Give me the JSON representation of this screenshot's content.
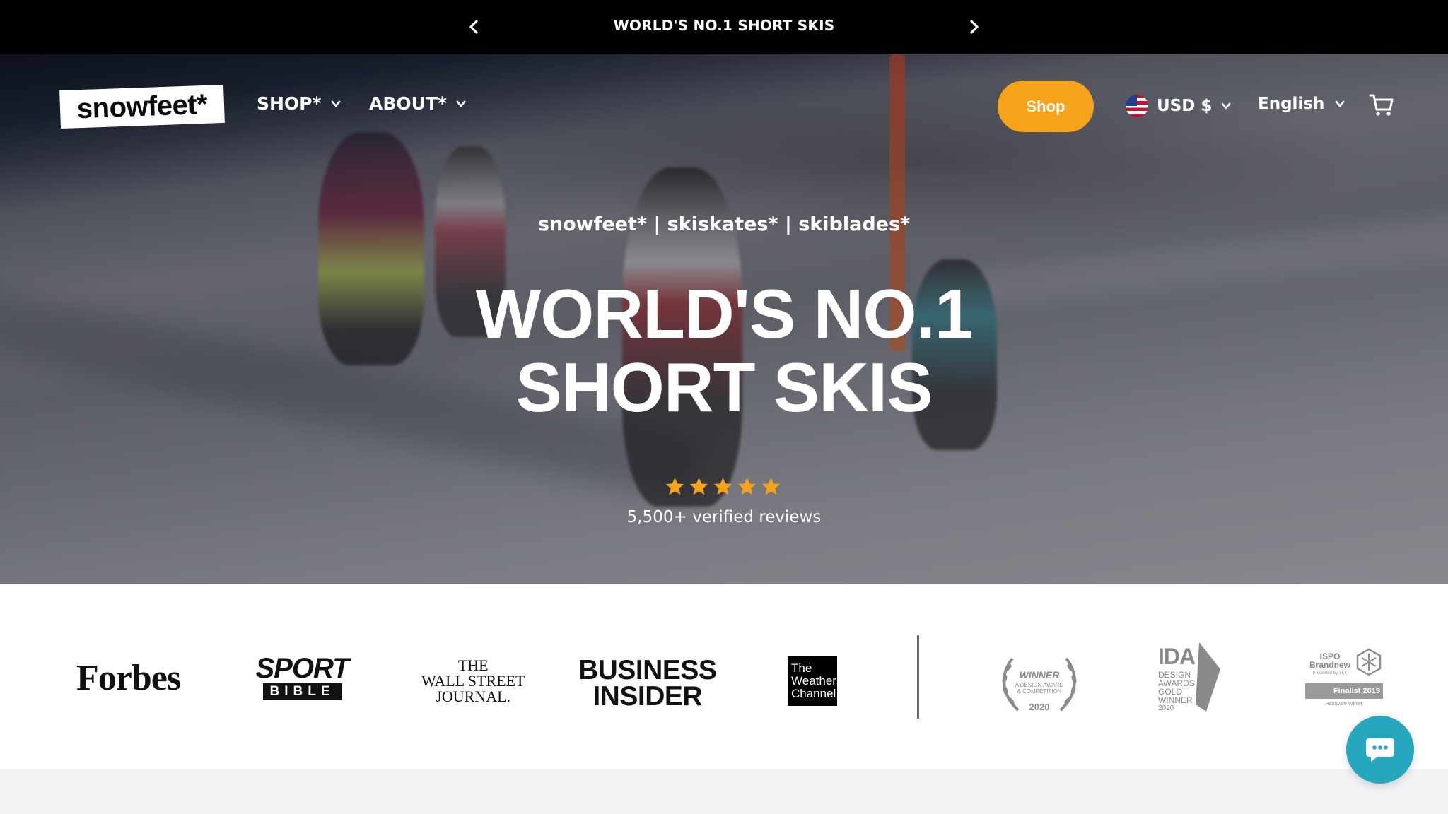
{
  "announcement": {
    "message": "WORLD'S NO.1 SHORT SKIS"
  },
  "header": {
    "logo_text": "snowfeet*",
    "nav": [
      {
        "label": "SHOP*"
      },
      {
        "label": "ABOUT*"
      }
    ],
    "shop_button": "Shop",
    "currency": "USD $",
    "language": "English"
  },
  "hero": {
    "tagline": "snowfeet* | skiskates* | skiblades*",
    "headline_line1": "WORLD'S NO.1",
    "headline_line2": "SHORT SKIS",
    "rating_stars": 5,
    "reviews": "5,500+ verified reviews"
  },
  "press": {
    "logos": [
      {
        "name": "Forbes",
        "text": "Forbes"
      },
      {
        "name": "SportBible",
        "text_top": "SPORT",
        "text_bottom": "BIBLE"
      },
      {
        "name": "WSJ",
        "line1": "THE",
        "line2": "WALL STREET",
        "line3": "JOURNAL."
      },
      {
        "name": "Business Insider",
        "line1": "BUSINESS",
        "line2": "INSIDER"
      },
      {
        "name": "The Weather Channel",
        "line1": "The",
        "line2": "Weather",
        "line3": "Channel"
      }
    ],
    "awards": [
      {
        "line1": "WINNER",
        "line2": "A'DESIGN AWARD",
        "line3": "& COMPETITION",
        "year": "2020"
      },
      {
        "title": "IDA",
        "line1": "DESIGN",
        "line2": "AWARDS",
        "line3": "GOLD",
        "line4": "WINNER",
        "year": "2020"
      },
      {
        "line1": "ISPO",
        "line2": "Brandnew",
        "line3": "Presented by YKK",
        "badge": "Finalist 2019",
        "line4": "Hardware Winter"
      }
    ]
  },
  "colors": {
    "accent": "#f6a21a",
    "star": "#f6a21a",
    "chat": "#27a6c0",
    "announcement_bg": "#000000"
  },
  "icons": {
    "prev": "chevron-left-icon",
    "next": "chevron-right-icon",
    "cart": "cart-icon",
    "chat": "chat-icon",
    "flag": "us-flag-icon",
    "star": "star-icon"
  }
}
